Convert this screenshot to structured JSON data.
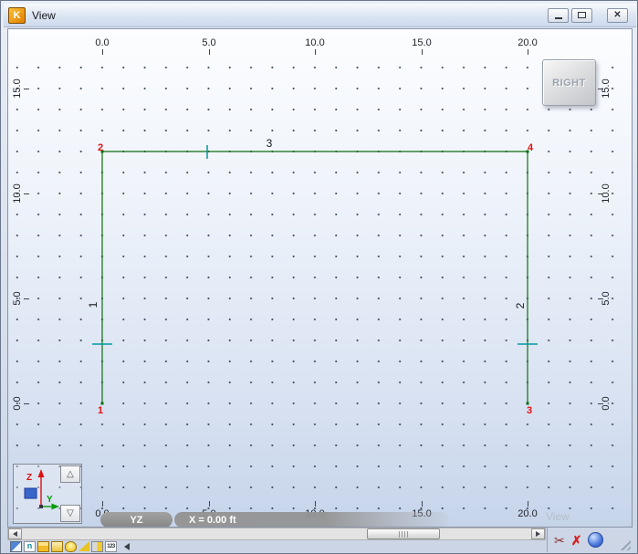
{
  "window": {
    "title": "View",
    "app_icon_letter": "K",
    "controls": {
      "close_glyph": "✕"
    }
  },
  "canvas": {
    "rulers": {
      "top": [
        "0.0",
        "5.0",
        "10.0",
        "15.0",
        "20.0"
      ],
      "bottom": [
        "0.0",
        "5.0",
        "10.0",
        "15.0",
        "20.0"
      ],
      "left": [
        "15.0",
        "10.0",
        "5.0",
        "0.0"
      ],
      "right": [
        "15.0",
        "10.0",
        "5.0",
        "0.0"
      ]
    },
    "view_button_label": "RIGHT",
    "watermark": "View",
    "structure": {
      "nodes": {
        "n1": "1",
        "n2": "2",
        "n3": "3",
        "n4": "4"
      },
      "members": {
        "m1": "1",
        "m2": "2",
        "m3": "3"
      }
    },
    "axis_widget": {
      "z_label": "Z",
      "y_label": "Y",
      "up_glyph": "△",
      "down_glyph": "▽"
    }
  },
  "statusbar": {
    "plane": "YZ",
    "coordinate": "X = 0.00 ft"
  },
  "bottom_toolbar": {
    "n_icon_glyph": "n",
    "numbers_icon_label": "123",
    "scissors_glyph": "✂",
    "delete_glyph": "✗"
  },
  "colors": {
    "member_green": "#0e6e0e",
    "node_label_red": "#e01212",
    "midpoint_tick_teal": "#00989e",
    "axis_z_red": "#dd1111",
    "axis_y_green": "#0a9a0a",
    "axis_plane_blue": "#3a66cc",
    "canvas_top": "#fcfdff",
    "canvas_bottom": "#c6d4ea"
  }
}
